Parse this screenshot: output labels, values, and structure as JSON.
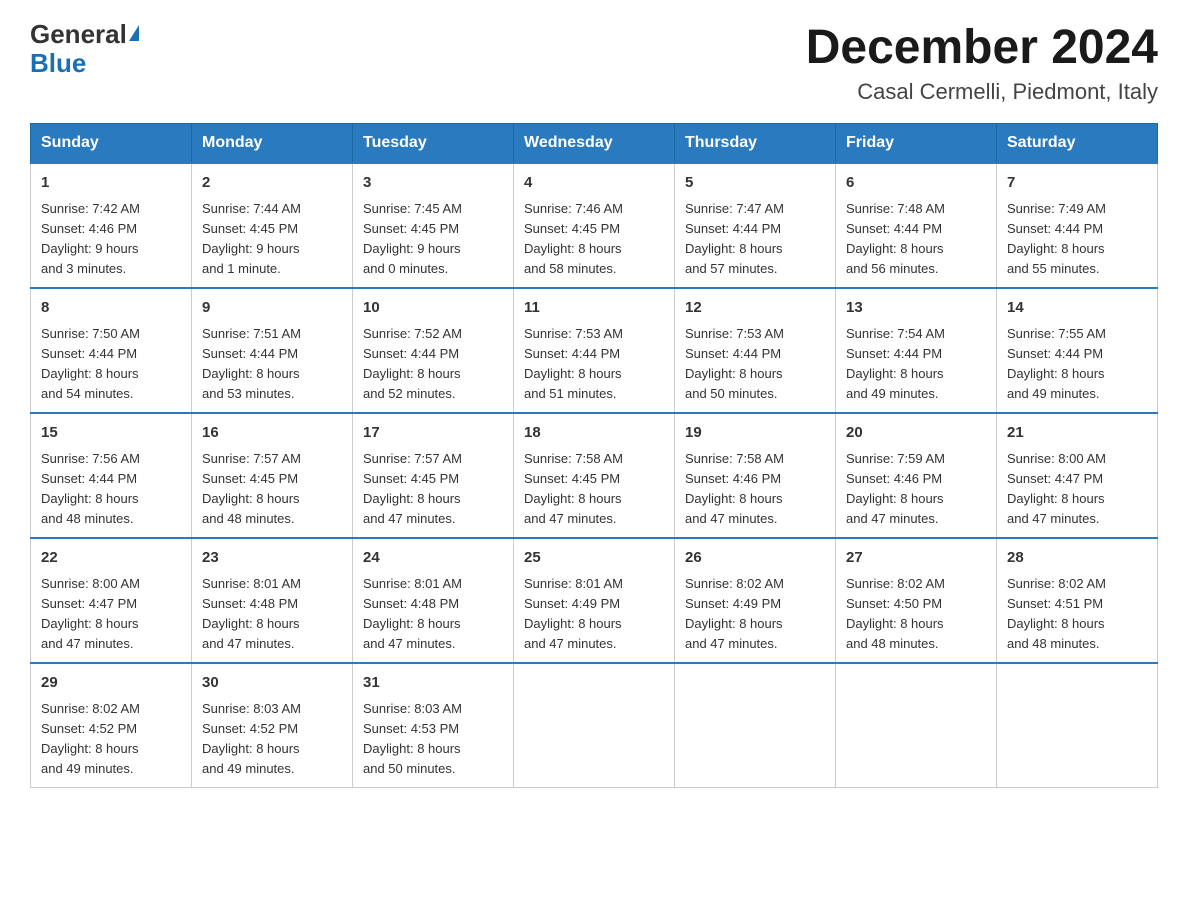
{
  "header": {
    "logo_general": "General",
    "logo_blue": "Blue",
    "month_title": "December 2024",
    "location": "Casal Cermelli, Piedmont, Italy"
  },
  "weekdays": [
    "Sunday",
    "Monday",
    "Tuesday",
    "Wednesday",
    "Thursday",
    "Friday",
    "Saturday"
  ],
  "weeks": [
    [
      {
        "day": "1",
        "sunrise": "7:42 AM",
        "sunset": "4:46 PM",
        "daylight": "9 hours and 3 minutes."
      },
      {
        "day": "2",
        "sunrise": "7:44 AM",
        "sunset": "4:45 PM",
        "daylight": "9 hours and 1 minute."
      },
      {
        "day": "3",
        "sunrise": "7:45 AM",
        "sunset": "4:45 PM",
        "daylight": "9 hours and 0 minutes."
      },
      {
        "day": "4",
        "sunrise": "7:46 AM",
        "sunset": "4:45 PM",
        "daylight": "8 hours and 58 minutes."
      },
      {
        "day": "5",
        "sunrise": "7:47 AM",
        "sunset": "4:44 PM",
        "daylight": "8 hours and 57 minutes."
      },
      {
        "day": "6",
        "sunrise": "7:48 AM",
        "sunset": "4:44 PM",
        "daylight": "8 hours and 56 minutes."
      },
      {
        "day": "7",
        "sunrise": "7:49 AM",
        "sunset": "4:44 PM",
        "daylight": "8 hours and 55 minutes."
      }
    ],
    [
      {
        "day": "8",
        "sunrise": "7:50 AM",
        "sunset": "4:44 PM",
        "daylight": "8 hours and 54 minutes."
      },
      {
        "day": "9",
        "sunrise": "7:51 AM",
        "sunset": "4:44 PM",
        "daylight": "8 hours and 53 minutes."
      },
      {
        "day": "10",
        "sunrise": "7:52 AM",
        "sunset": "4:44 PM",
        "daylight": "8 hours and 52 minutes."
      },
      {
        "day": "11",
        "sunrise": "7:53 AM",
        "sunset": "4:44 PM",
        "daylight": "8 hours and 51 minutes."
      },
      {
        "day": "12",
        "sunrise": "7:53 AM",
        "sunset": "4:44 PM",
        "daylight": "8 hours and 50 minutes."
      },
      {
        "day": "13",
        "sunrise": "7:54 AM",
        "sunset": "4:44 PM",
        "daylight": "8 hours and 49 minutes."
      },
      {
        "day": "14",
        "sunrise": "7:55 AM",
        "sunset": "4:44 PM",
        "daylight": "8 hours and 49 minutes."
      }
    ],
    [
      {
        "day": "15",
        "sunrise": "7:56 AM",
        "sunset": "4:44 PM",
        "daylight": "8 hours and 48 minutes."
      },
      {
        "day": "16",
        "sunrise": "7:57 AM",
        "sunset": "4:45 PM",
        "daylight": "8 hours and 48 minutes."
      },
      {
        "day": "17",
        "sunrise": "7:57 AM",
        "sunset": "4:45 PM",
        "daylight": "8 hours and 47 minutes."
      },
      {
        "day": "18",
        "sunrise": "7:58 AM",
        "sunset": "4:45 PM",
        "daylight": "8 hours and 47 minutes."
      },
      {
        "day": "19",
        "sunrise": "7:58 AM",
        "sunset": "4:46 PM",
        "daylight": "8 hours and 47 minutes."
      },
      {
        "day": "20",
        "sunrise": "7:59 AM",
        "sunset": "4:46 PM",
        "daylight": "8 hours and 47 minutes."
      },
      {
        "day": "21",
        "sunrise": "8:00 AM",
        "sunset": "4:47 PM",
        "daylight": "8 hours and 47 minutes."
      }
    ],
    [
      {
        "day": "22",
        "sunrise": "8:00 AM",
        "sunset": "4:47 PM",
        "daylight": "8 hours and 47 minutes."
      },
      {
        "day": "23",
        "sunrise": "8:01 AM",
        "sunset": "4:48 PM",
        "daylight": "8 hours and 47 minutes."
      },
      {
        "day": "24",
        "sunrise": "8:01 AM",
        "sunset": "4:48 PM",
        "daylight": "8 hours and 47 minutes."
      },
      {
        "day": "25",
        "sunrise": "8:01 AM",
        "sunset": "4:49 PM",
        "daylight": "8 hours and 47 minutes."
      },
      {
        "day": "26",
        "sunrise": "8:02 AM",
        "sunset": "4:49 PM",
        "daylight": "8 hours and 47 minutes."
      },
      {
        "day": "27",
        "sunrise": "8:02 AM",
        "sunset": "4:50 PM",
        "daylight": "8 hours and 48 minutes."
      },
      {
        "day": "28",
        "sunrise": "8:02 AM",
        "sunset": "4:51 PM",
        "daylight": "8 hours and 48 minutes."
      }
    ],
    [
      {
        "day": "29",
        "sunrise": "8:02 AM",
        "sunset": "4:52 PM",
        "daylight": "8 hours and 49 minutes."
      },
      {
        "day": "30",
        "sunrise": "8:03 AM",
        "sunset": "4:52 PM",
        "daylight": "8 hours and 49 minutes."
      },
      {
        "day": "31",
        "sunrise": "8:03 AM",
        "sunset": "4:53 PM",
        "daylight": "8 hours and 50 minutes."
      },
      null,
      null,
      null,
      null
    ]
  ],
  "labels": {
    "sunrise": "Sunrise:",
    "sunset": "Sunset:",
    "daylight": "Daylight:"
  }
}
